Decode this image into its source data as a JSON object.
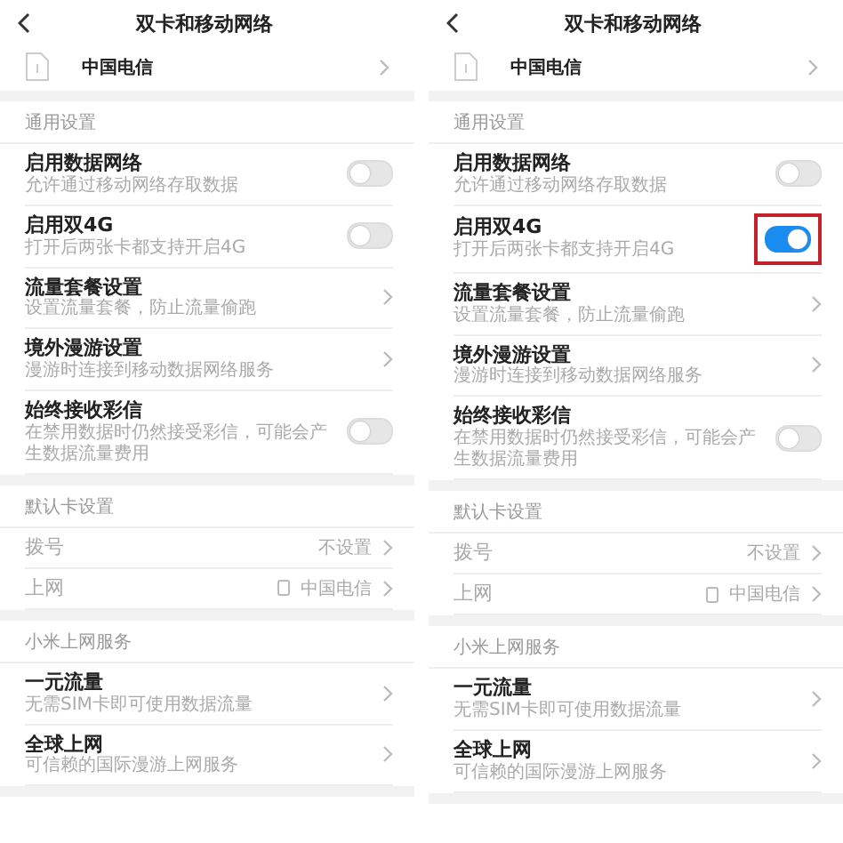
{
  "screens": [
    {
      "title": "双卡和移动网络",
      "sim": {
        "name": "中国电信"
      },
      "sections": [
        {
          "header": "通用设置",
          "rows": [
            {
              "kind": "toggle",
              "title": "启用数据网络",
              "subtitle": "允许通过移动网络存取数据",
              "on": false,
              "highlighted": false
            },
            {
              "kind": "toggle",
              "title": "启用双4G",
              "subtitle": "打开后两张卡都支持开启4G",
              "on": false,
              "highlighted": false
            },
            {
              "kind": "link",
              "title": "流量套餐设置",
              "subtitle": "设置流量套餐，防止流量偷跑"
            },
            {
              "kind": "link",
              "title": "境外漫游设置",
              "subtitle": "漫游时连接到移动数据网络服务"
            },
            {
              "kind": "toggle",
              "title": "始终接收彩信",
              "subtitle": "在禁用数据时仍然接受彩信，可能会产生数据流量费用",
              "on": false,
              "highlighted": false
            }
          ]
        },
        {
          "header": "默认卡设置",
          "rows": [
            {
              "kind": "value",
              "title": "拨号",
              "value": "不设置",
              "sim_icon": false,
              "disabled": true
            },
            {
              "kind": "value",
              "title": "上网",
              "value": "中国电信",
              "sim_icon": true,
              "disabled": true
            }
          ]
        },
        {
          "header": "小米上网服务",
          "rows": [
            {
              "kind": "link",
              "title": "一元流量",
              "subtitle": "无需SIM卡即可使用数据流量"
            },
            {
              "kind": "link",
              "title": "全球上网",
              "subtitle": "可信赖的国际漫游上网服务"
            }
          ]
        }
      ]
    },
    {
      "title": "双卡和移动网络",
      "sim": {
        "name": "中国电信"
      },
      "sections": [
        {
          "header": "通用设置",
          "rows": [
            {
              "kind": "toggle",
              "title": "启用数据网络",
              "subtitle": "允许通过移动网络存取数据",
              "on": false,
              "highlighted": false
            },
            {
              "kind": "toggle",
              "title": "启用双4G",
              "subtitle": "打开后两张卡都支持开启4G",
              "on": true,
              "highlighted": true
            },
            {
              "kind": "link",
              "title": "流量套餐设置",
              "subtitle": "设置流量套餐，防止流量偷跑"
            },
            {
              "kind": "link",
              "title": "境外漫游设置",
              "subtitle": "漫游时连接到移动数据网络服务"
            },
            {
              "kind": "toggle",
              "title": "始终接收彩信",
              "subtitle": "在禁用数据时仍然接受彩信，可能会产生数据流量费用",
              "on": false,
              "highlighted": false
            }
          ]
        },
        {
          "header": "默认卡设置",
          "rows": [
            {
              "kind": "value",
              "title": "拨号",
              "value": "不设置",
              "sim_icon": false,
              "disabled": true
            },
            {
              "kind": "value",
              "title": "上网",
              "value": "中国电信",
              "sim_icon": true,
              "disabled": true
            }
          ]
        },
        {
          "header": "小米上网服务",
          "rows": [
            {
              "kind": "link",
              "title": "一元流量",
              "subtitle": "无需SIM卡即可使用数据流量"
            },
            {
              "kind": "link",
              "title": "全球上网",
              "subtitle": "可信赖的国际漫游上网服务"
            }
          ]
        }
      ]
    }
  ]
}
